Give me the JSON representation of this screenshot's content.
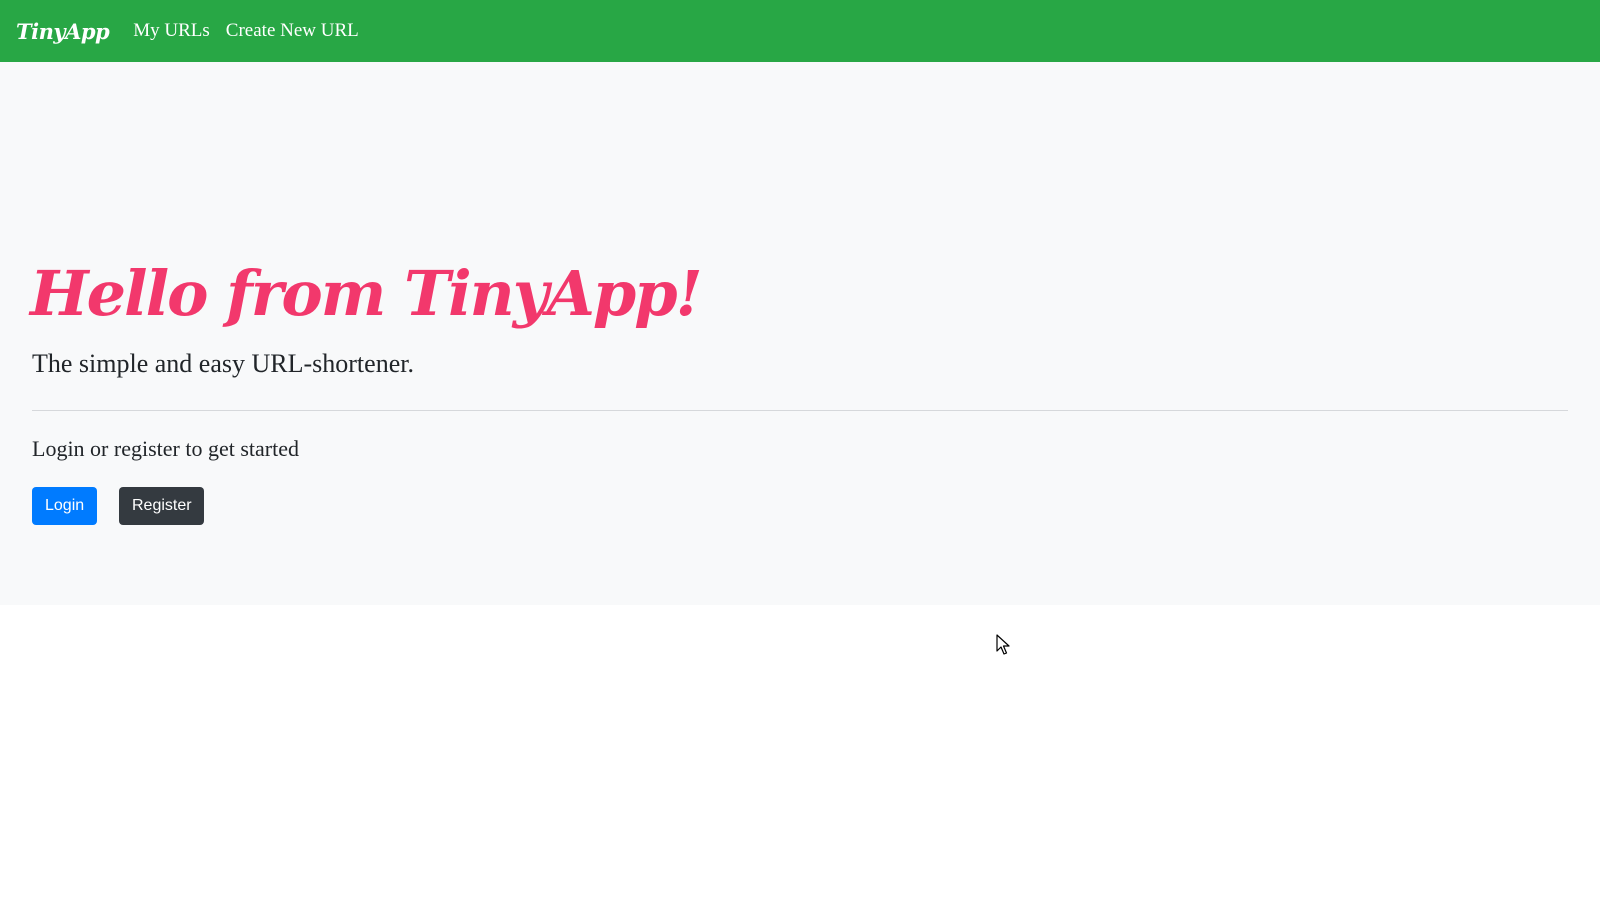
{
  "navbar": {
    "brand": "TinyApp",
    "links": [
      "My URLs",
      "Create New URL"
    ],
    "background_color": "#28a745"
  },
  "hero": {
    "title": "Hello from TinyApp!",
    "title_color": "#f2386c",
    "subtitle": "The simple and easy URL-shortener.",
    "cta_text": "Login or register to get started"
  },
  "buttons": {
    "login": "Login",
    "register": "Register",
    "login_color": "#007bff",
    "register_color": "#343a40"
  },
  "cursor": {
    "icon": "arrow-pointer-icon"
  }
}
